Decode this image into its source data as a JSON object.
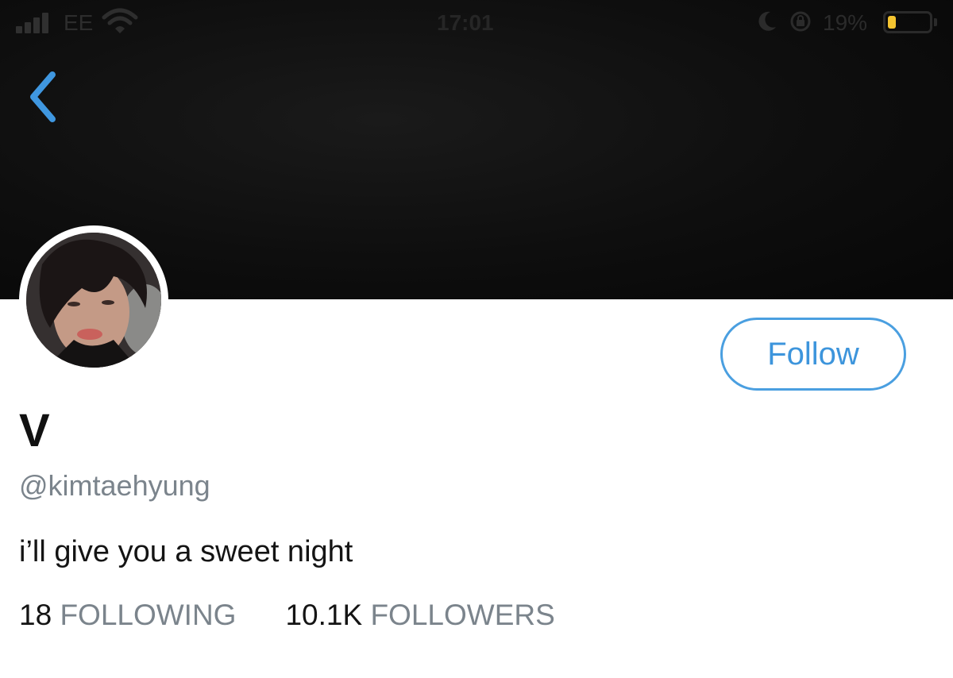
{
  "status_bar": {
    "carrier": "EE",
    "time": "17:01",
    "battery_percent": "19%",
    "battery_level": 0.19,
    "battery_color": "#f4c430",
    "signal_icon": "signal-bars-icon",
    "wifi_icon": "wifi-icon",
    "moon_icon": "do-not-disturb-moon-icon",
    "rotation_lock_icon": "rotation-lock-icon"
  },
  "nav": {
    "back_icon": "chevron-left-icon"
  },
  "profile": {
    "display_name": "V",
    "handle": "@kimtaehyung",
    "bio": "i’ll give you a sweet night",
    "follow_label": "Follow",
    "following_count": "18",
    "following_label": "FOLLOWING",
    "followers_count": "10.1K",
    "followers_label": "FOLLOWERS"
  },
  "colors": {
    "accent": "#4a9fe0",
    "banner": "#0e0e0e",
    "secondary_text": "#7b848c"
  }
}
